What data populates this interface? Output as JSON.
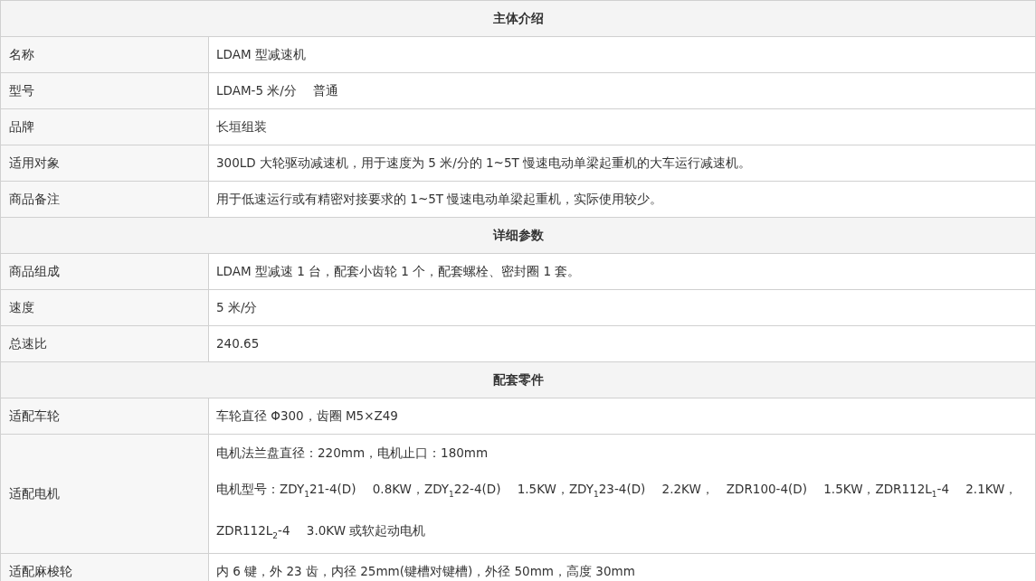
{
  "sections": [
    {
      "title": "主体介绍",
      "rows": [
        {
          "label": "名称",
          "values": [
            "LDAM 型减速机"
          ]
        },
        {
          "label": "型号",
          "values": [
            "LDAM-5 米/分　 普通"
          ]
        },
        {
          "label": "品牌",
          "values": [
            "长垣组装"
          ]
        },
        {
          "label": "适用对象",
          "values": [
            "300LD 大轮驱动减速机，用于速度为 5 米/分的 1~5T 慢速电动单梁起重机的大车运行减速机。"
          ]
        },
        {
          "label": "商品备注",
          "values": [
            "用于低速运行或有精密对接要求的 1~5T 慢速电动单梁起重机，实际使用较少。"
          ]
        }
      ]
    },
    {
      "title": "详细参数",
      "rows": [
        {
          "label": "商品组成",
          "values": [
            "LDAM 型减速 1 台，配套小齿轮 1 个，配套螺栓、密封圈 1 套。"
          ]
        },
        {
          "label": "速度",
          "values": [
            "5 米/分"
          ]
        },
        {
          "label": "总速比",
          "values": [
            "240.65"
          ]
        }
      ]
    },
    {
      "title": "配套零件",
      "rows": [
        {
          "label": "适配车轮",
          "values": [
            "车轮直径 Φ300，齿圈 M5×Z49"
          ]
        },
        {
          "label": "适配电机",
          "values": [
            "电机法兰盘直径：220mm，电机止口：180mm",
            "电机型号：ZDY$_{1}$21-4(D)　 0.8KW，ZDY$_{1}$22-4(D)　 1.5KW，ZDY$_{1}$23-4(D)　 2.2KW，　ZDR100-4(D)　 1.5KW，ZDR112L$_{1}$-4　 2.1KW，ZDR112L$_{2}$-4　 3.0KW 或软起动电机"
          ]
        },
        {
          "label": "适配麻梭轮",
          "values": [
            "内 6 键，外 23 齿，内径 25mm(键槽对键槽)，外径 50mm，高度 30mm"
          ]
        }
      ]
    }
  ]
}
